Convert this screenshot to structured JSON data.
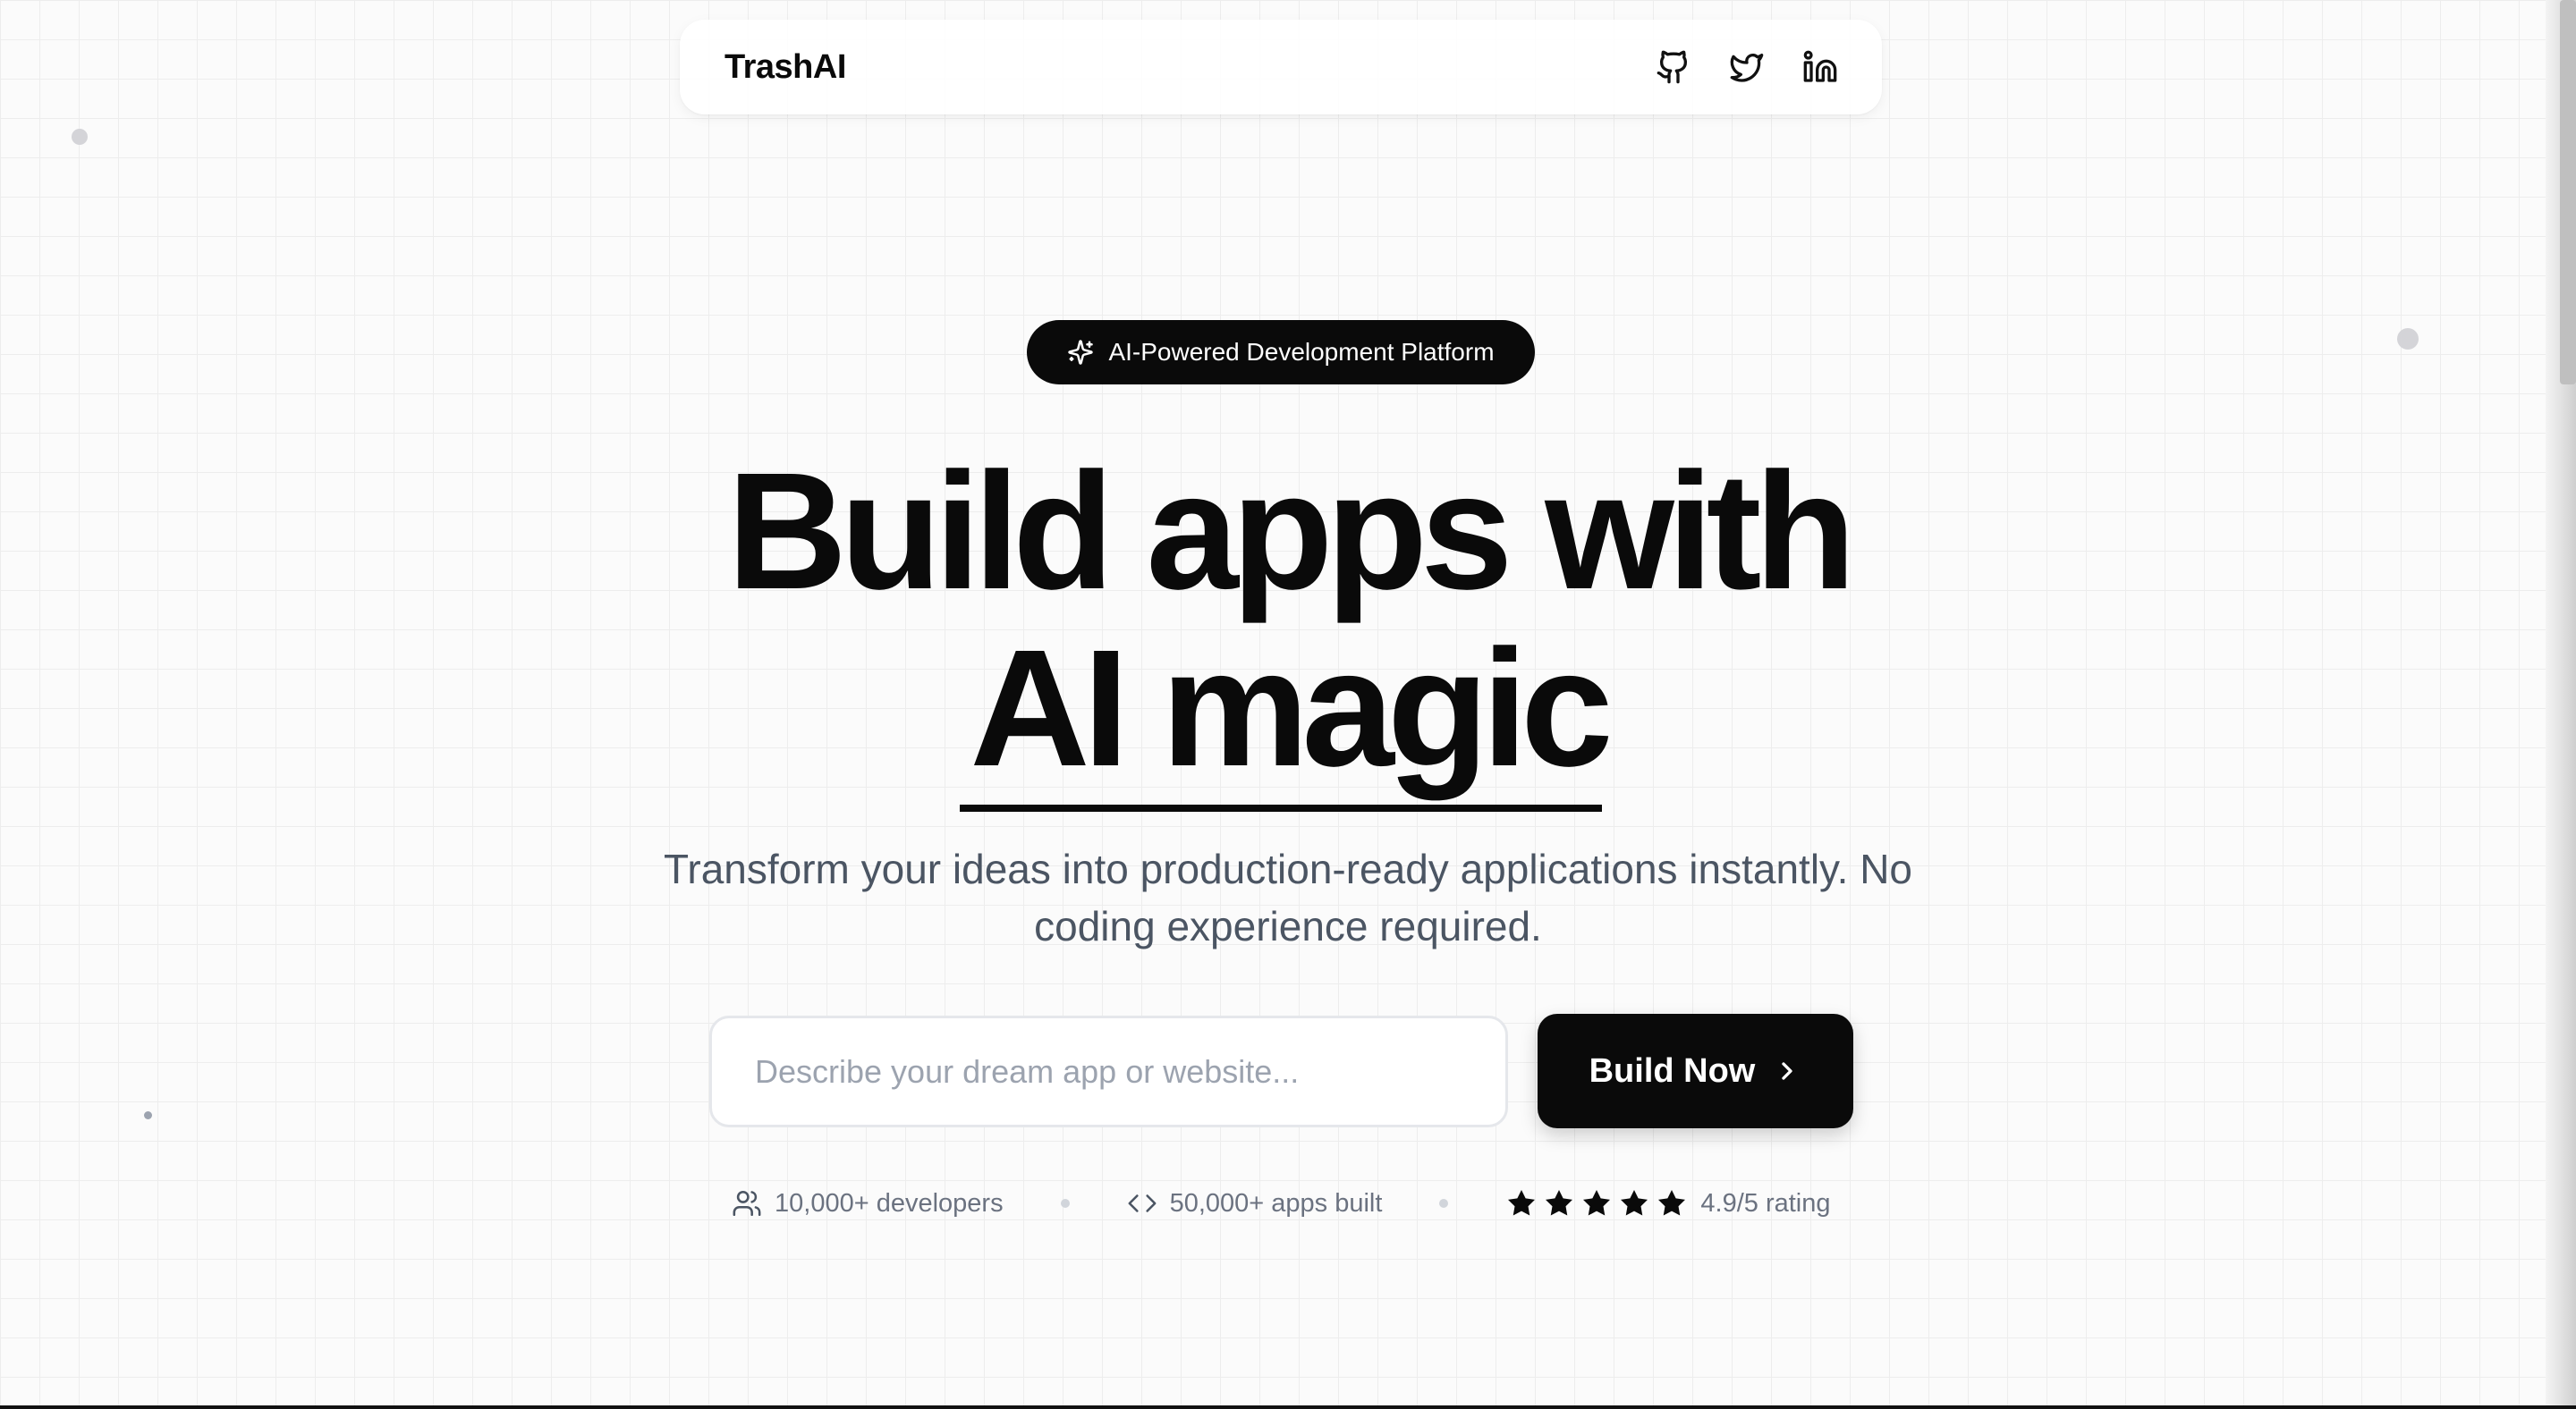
{
  "nav": {
    "brand": "TrashAI",
    "links": [
      {
        "icon": "github-icon"
      },
      {
        "icon": "twitter-icon"
      },
      {
        "icon": "linkedin-icon"
      }
    ]
  },
  "hero": {
    "badge": "AI-Powered Development Platform",
    "title_line1": "Build apps with",
    "title_line2": "AI magic",
    "subtitle": "Transform your ideas into production-ready applications instantly. No coding experience required.",
    "input_placeholder": "Describe your dream app or website...",
    "input_value": "",
    "cta_label": "Build Now"
  },
  "stats": {
    "developers": "10,000+ developers",
    "apps": "50,000+ apps built",
    "rating_stars": 5,
    "rating": "4.9/5 rating"
  },
  "colors": {
    "primary": "#0a0a0a",
    "muted_text": "#4b5563",
    "subtle_text": "#6b7280",
    "background": "#fbfbfb",
    "grid_line": "#ededed"
  }
}
